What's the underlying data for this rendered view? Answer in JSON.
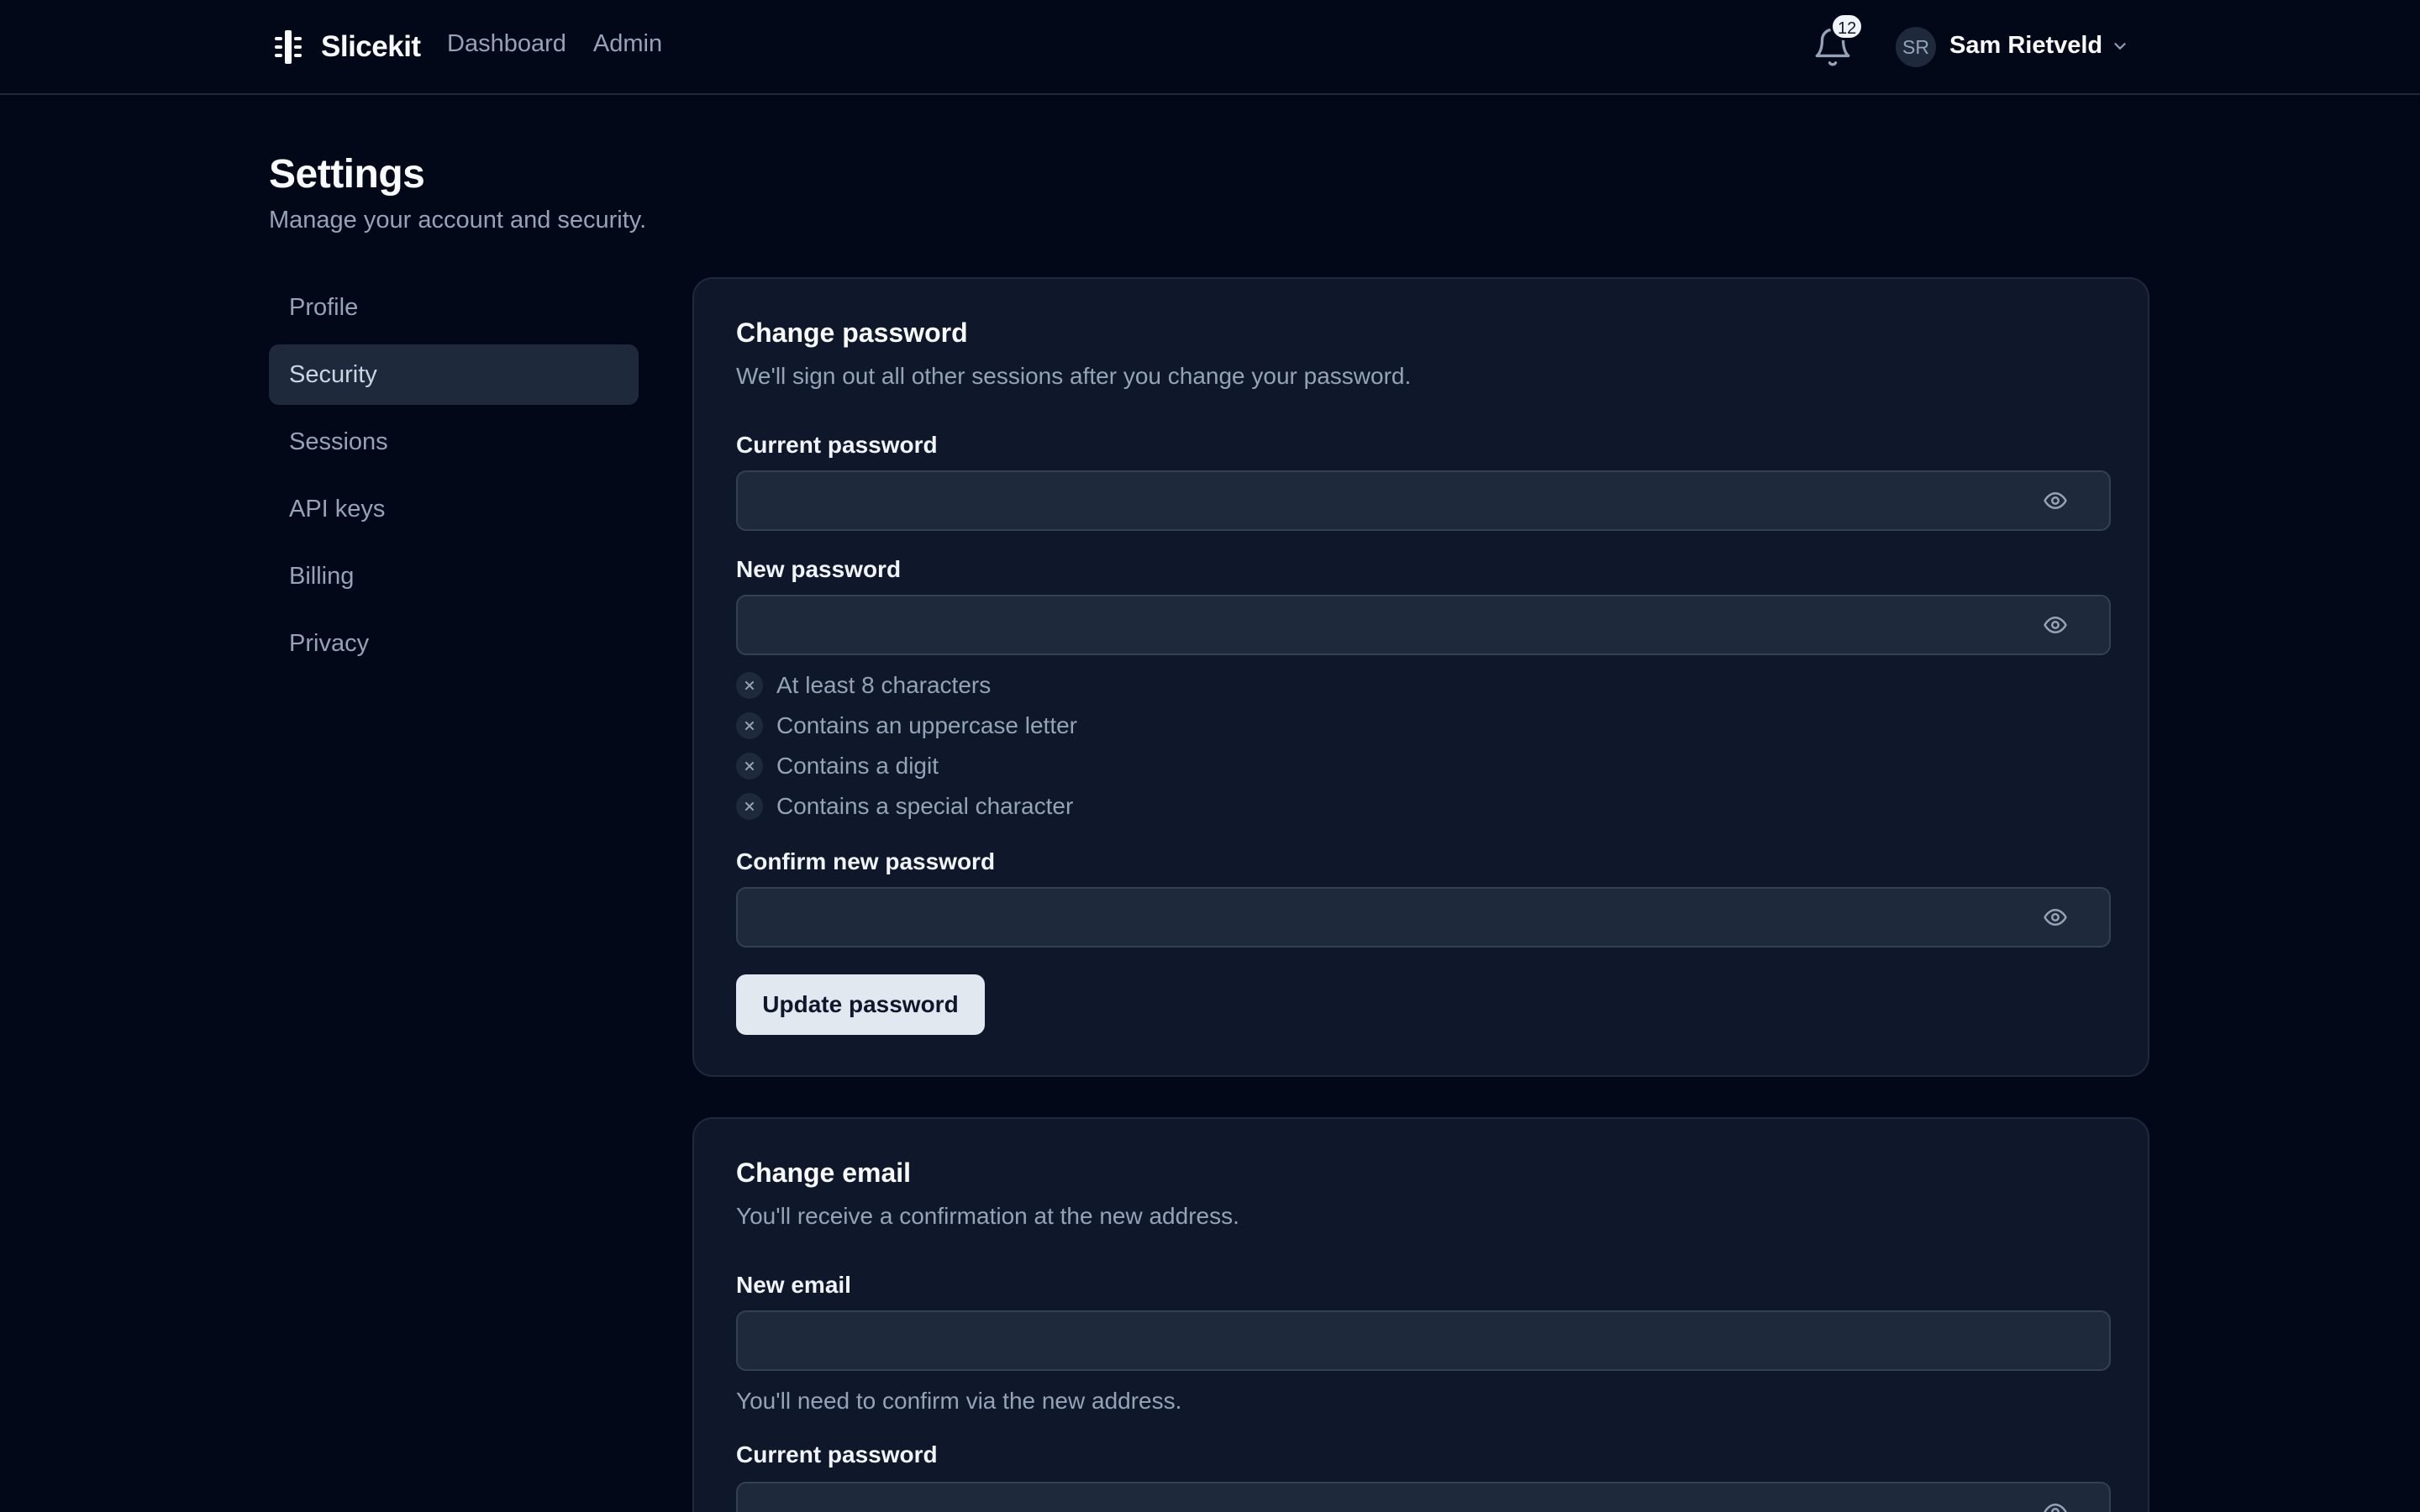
{
  "app": {
    "name": "Slicekit",
    "nav": [
      "Dashboard",
      "Admin"
    ]
  },
  "header": {
    "notification_count": "12",
    "user_initials": "SR",
    "user_name": "Sam Rietveld"
  },
  "page": {
    "title": "Settings",
    "subtitle": "Manage your account and security."
  },
  "sidebar": {
    "items": [
      {
        "label": "Profile"
      },
      {
        "label": "Security",
        "active": true
      },
      {
        "label": "Sessions"
      },
      {
        "label": "API keys"
      },
      {
        "label": "Billing"
      },
      {
        "label": "Privacy"
      }
    ]
  },
  "password_card": {
    "title": "Change password",
    "description": "We'll sign out all other sessions after you change your password.",
    "current_label": "Current password",
    "current_value": "",
    "new_label": "New password",
    "new_value": "",
    "rules": [
      {
        "text": "At least 8 characters",
        "met": false
      },
      {
        "text": "Contains an uppercase letter",
        "met": false
      },
      {
        "text": "Contains a digit",
        "met": false
      },
      {
        "text": "Contains a special character",
        "met": false
      }
    ],
    "confirm_label": "Confirm new password",
    "confirm_value": "",
    "submit_label": "Update password"
  },
  "email_card": {
    "title": "Change email",
    "description": "You'll receive a confirmation at the new address.",
    "new_email_label": "New email",
    "new_email_value": "",
    "new_email_hint": "You'll need to confirm via the new address.",
    "current_password_label": "Current password",
    "current_password_value": ""
  },
  "colors": {
    "background": "#020817",
    "card": "#0f172a",
    "border": "#1e293b",
    "muted_text": "#94a3b8",
    "primary_button": "#e2e8f0"
  },
  "icons": [
    "logo-icon",
    "bell-icon",
    "chevron-down-icon",
    "eye-icon",
    "x-icon"
  ]
}
